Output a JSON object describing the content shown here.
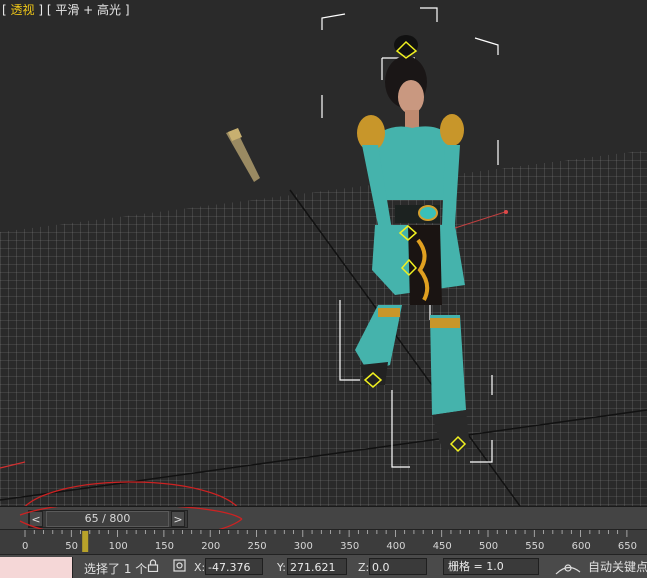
{
  "viewport": {
    "label_prefix": "[ ",
    "view_name": "透视",
    "label_middle": " ] [ 平滑 + 高光 ]"
  },
  "time_slider": {
    "prev_arrow": "<",
    "next_arrow": ">",
    "frame_display": "65 / 800",
    "current_frame": 65,
    "total_frames": 800
  },
  "track_bar": {
    "ticks": [
      "0",
      "50",
      "100",
      "150",
      "200",
      "250",
      "300",
      "350",
      "400",
      "450",
      "500",
      "550",
      "600",
      "650"
    ],
    "key_frame": 65,
    "key_color": "#b8a22a"
  },
  "status_bar": {
    "selection_text": "选择了 1 个",
    "lock_icon": "lock-icon",
    "transform_icon": "absolute-mode-icon",
    "x_label": "X:",
    "x_value": "-47.376",
    "y_label": "Y:",
    "y_value": "271.621",
    "z_label": "Z:",
    "z_value": "0.0",
    "grid_text": "栅格 = 1.0",
    "autokey_text": "自动关键点"
  },
  "colors": {
    "active_view": "#f0c818",
    "selection_bracket": "#ffffff",
    "annotation_circle": "#cc2222",
    "character_outfit": "#46b4ac"
  }
}
